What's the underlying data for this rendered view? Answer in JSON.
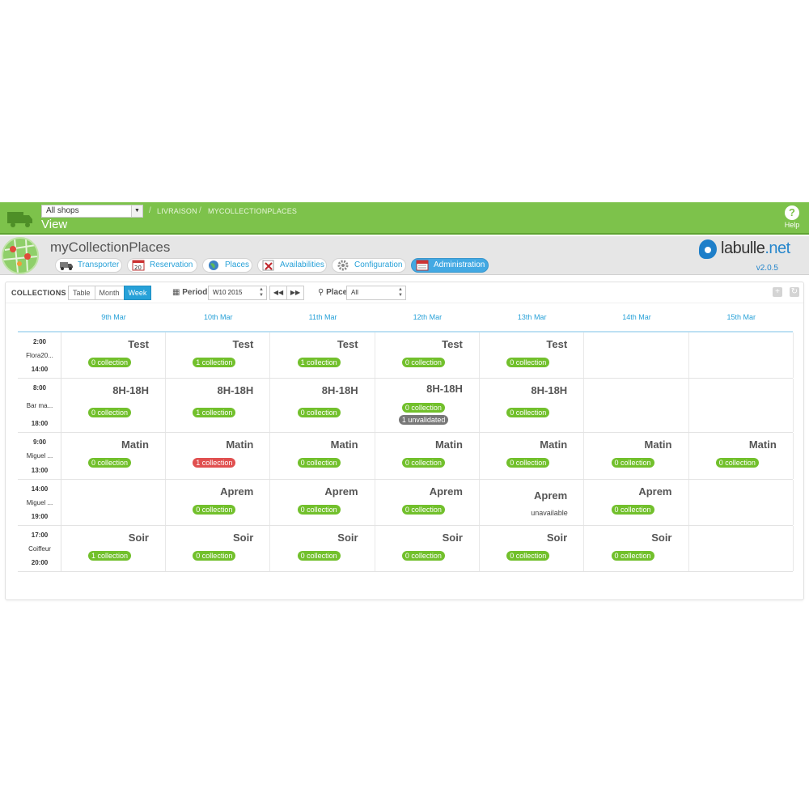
{
  "topbar": {
    "shop_select": "All shops",
    "breadcrumb": [
      "LIVRAISON",
      "MYCOLLECTIONPLACES"
    ],
    "view_title": "View",
    "help_label": "Help"
  },
  "module": {
    "title": "myCollectionPlaces",
    "tabs": [
      {
        "label": "Transporter",
        "icon": "truck-icon"
      },
      {
        "label": "Reservation",
        "icon": "calendar-icon"
      },
      {
        "label": "Places",
        "icon": "globe-icon"
      },
      {
        "label": "Availabilities",
        "icon": "calendar-x-icon"
      },
      {
        "label": "Configuration",
        "icon": "gear-icon"
      },
      {
        "label": "Administration",
        "icon": "admin-calendar-icon"
      }
    ],
    "active_tab": "Administration",
    "brand": {
      "name_a": "labulle",
      "name_b": ".net",
      "version": "v2.0.5"
    }
  },
  "panel": {
    "title": "COLLECTIONS",
    "views": [
      "Table",
      "Month",
      "Week"
    ],
    "active_view": "Week",
    "period_label": "Period",
    "period_value": "W10 2015",
    "place_label": "Place",
    "place_value": "All"
  },
  "calendar": {
    "days": [
      "9th Mar",
      "10th Mar",
      "11th Mar",
      "12th Mar",
      "13th Mar",
      "14th Mar",
      "15th Mar"
    ],
    "rows": [
      {
        "start": "2:00",
        "name": "Flora20...",
        "end": "14:00",
        "cells": [
          {
            "title": "Test",
            "badge": "0 collection"
          },
          {
            "title": "Test",
            "badge": "1 collection"
          },
          {
            "title": "Test",
            "badge": "1 collection"
          },
          {
            "title": "Test",
            "badge": "0 collection"
          },
          {
            "title": "Test",
            "badge": "0 collection"
          },
          {
            "title": "",
            "badge": ""
          },
          {
            "title": "",
            "badge": ""
          }
        ]
      },
      {
        "start": "8:00",
        "name": "Bar ma...",
        "end": "18:00",
        "cells": [
          {
            "title": "8H-18H",
            "badge": "0 collection"
          },
          {
            "title": "8H-18H",
            "badge": "1 collection"
          },
          {
            "title": "8H-18H",
            "badge": "0 collection"
          },
          {
            "title": "8H-18H",
            "badge": "0 collection",
            "extra": "1 unvalidated"
          },
          {
            "title": "8H-18H",
            "badge": "0 collection"
          },
          {
            "title": "",
            "badge": ""
          },
          {
            "title": "",
            "badge": ""
          }
        ]
      },
      {
        "start": "9:00",
        "name": "Miguel ...",
        "end": "13:00",
        "cells": [
          {
            "title": "Matin",
            "badge": "0 collection"
          },
          {
            "title": "Matin",
            "badge": "1 collection",
            "badge_color": "red"
          },
          {
            "title": "Matin",
            "badge": "0 collection"
          },
          {
            "title": "Matin",
            "badge": "0 collection"
          },
          {
            "title": "Matin",
            "badge": "0 collection"
          },
          {
            "title": "Matin",
            "badge": "0 collection"
          },
          {
            "title": "Matin",
            "badge": "0 collection"
          }
        ]
      },
      {
        "start": "14:00",
        "name": "Miguel ...",
        "end": "19:00",
        "cells": [
          {
            "title": "",
            "badge": ""
          },
          {
            "title": "Aprem",
            "badge": "0 collection"
          },
          {
            "title": "Aprem",
            "badge": "0 collection"
          },
          {
            "title": "Aprem",
            "badge": "0 collection"
          },
          {
            "title": "Aprem",
            "badge": "",
            "status": "unavailable"
          },
          {
            "title": "Aprem",
            "badge": "0 collection"
          },
          {
            "title": "",
            "badge": ""
          }
        ]
      },
      {
        "start": "17:00",
        "name": "Coiffeur",
        "end": "20:00",
        "cells": [
          {
            "title": "Soir",
            "badge": "1 collection"
          },
          {
            "title": "Soir",
            "badge": "0 collection"
          },
          {
            "title": "Soir",
            "badge": "0 collection"
          },
          {
            "title": "Soir",
            "badge": "0 collection"
          },
          {
            "title": "Soir",
            "badge": "0 collection"
          },
          {
            "title": "Soir",
            "badge": "0 collection"
          },
          {
            "title": "",
            "badge": ""
          }
        ]
      }
    ]
  },
  "colors": {
    "green": "#7dc24b",
    "badge_green": "#72c02c",
    "badge_red": "#e05050",
    "accent_blue": "#27a1d8"
  }
}
